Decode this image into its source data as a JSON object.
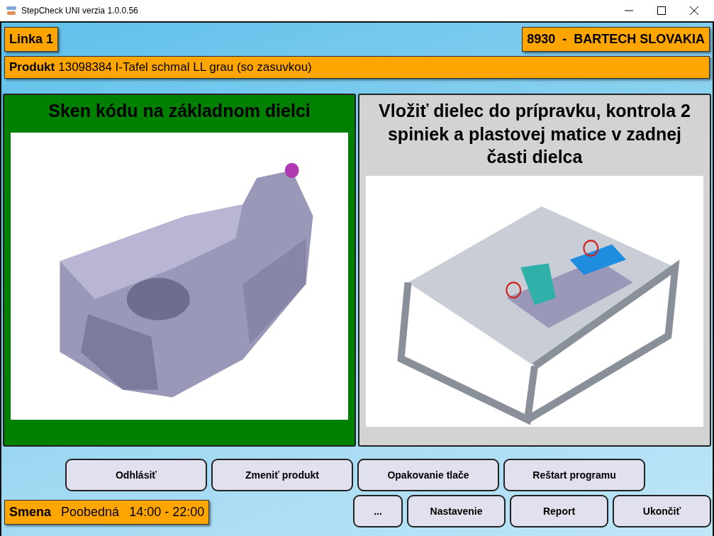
{
  "window": {
    "title": "StepCheck UNI verzia 1.0.0.56"
  },
  "line": {
    "label": "Linka 1"
  },
  "company": {
    "label": "8930  -  BARTECH SLOVAKIA"
  },
  "product": {
    "label": "Produkt",
    "value": "13098384 I-Tafel schmal LL grau (so zasuvkou)"
  },
  "steps": [
    {
      "title": "Sken kódu na základnom dielci",
      "color": "#008000"
    },
    {
      "title": "Vložiť dielec do prípravku, kontrola 2 spiniek a plastovej matice v zadnej časti dielca",
      "color": "#d3d3d3"
    }
  ],
  "buttons_top": [
    "Odhlásiť",
    "Zmeniť produkt",
    "Opakovanie tlače",
    "Reštart programu"
  ],
  "shift": {
    "label": "Smena",
    "name": "Poobedná",
    "time": "14:00 - 22:00"
  },
  "buttons_bottom": [
    "...",
    "Nastavenie",
    "Report",
    "Ukončiť"
  ]
}
